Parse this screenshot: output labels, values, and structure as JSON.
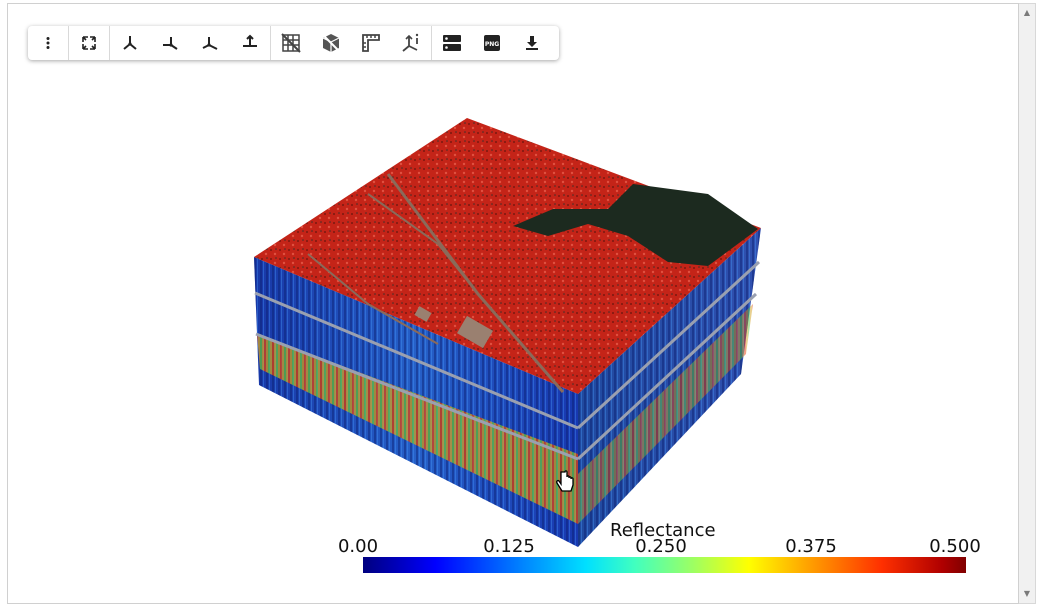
{
  "toolbar": {
    "buttons": [
      {
        "name": "menu-button",
        "icon": "more-vertical-icon"
      },
      {
        "name": "fullscreen-button",
        "icon": "expand-icon"
      },
      {
        "name": "view-axis-1-button",
        "icon": "axes-icon"
      },
      {
        "name": "view-axis-2-button",
        "icon": "axes-icon"
      },
      {
        "name": "view-axis-3-button",
        "icon": "axes-icon"
      },
      {
        "name": "view-axis-4-button",
        "icon": "axes-icon"
      },
      {
        "name": "toggle-grid-button",
        "icon": "grid-icon"
      },
      {
        "name": "toggle-bounds-button",
        "icon": "cube-icon"
      },
      {
        "name": "ruler-button",
        "icon": "ruler-icon"
      },
      {
        "name": "axes-info-button",
        "icon": "axes-info-icon"
      },
      {
        "name": "server-settings-button",
        "icon": "server-icon"
      },
      {
        "name": "save-png-button",
        "icon": "png-icon",
        "label": "PNG"
      },
      {
        "name": "download-button",
        "icon": "download-icon"
      }
    ]
  },
  "colorbar": {
    "title": "Reflectance",
    "ticks": [
      "0.00",
      "0.125",
      "0.250",
      "0.375",
      "0.500"
    ],
    "min": 0.0,
    "max": 0.5,
    "colormap": "jet"
  },
  "colors": {
    "surface_red": "#c8281c",
    "dark_patch": "#1c2a1f",
    "side_blue": "#1030a0"
  }
}
